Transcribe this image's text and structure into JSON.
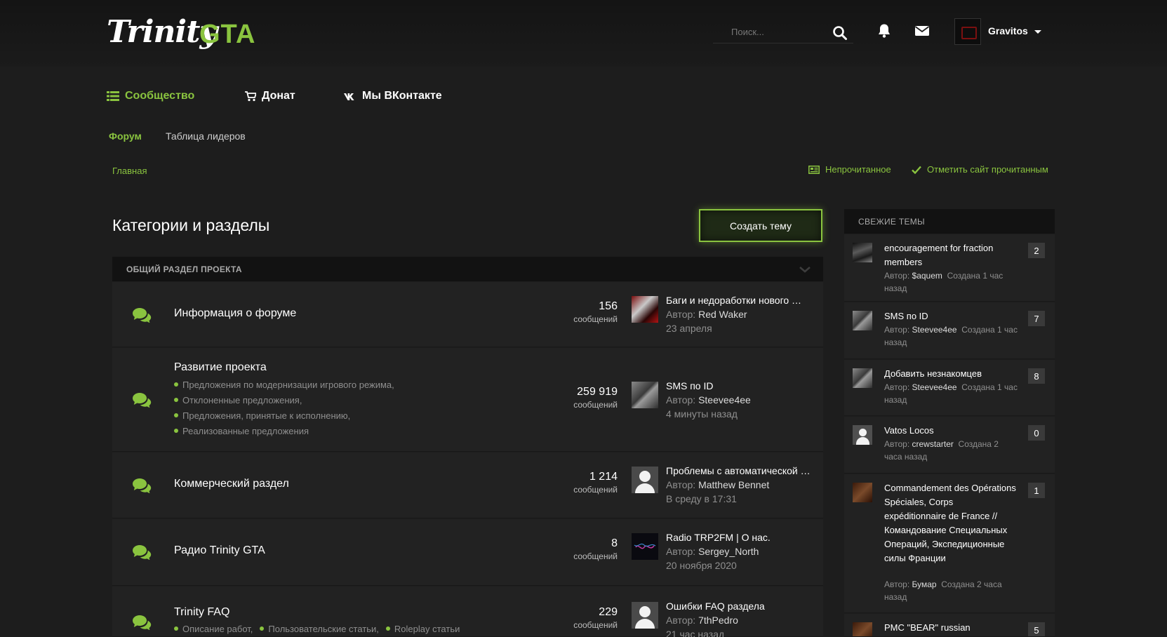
{
  "header": {
    "logo_left": "Trinity",
    "logo_right": "GTA",
    "search_placeholder": "Поиск...",
    "username": "Gravitos"
  },
  "nav": {
    "items": [
      {
        "label": "Сообщество",
        "icon": "list-icon"
      },
      {
        "label": "Донат",
        "icon": "cart-icon"
      },
      {
        "label": "Мы ВКонтакте",
        "icon": "vk-icon"
      }
    ],
    "sub": [
      "Форум",
      "Таблица лидеров"
    ]
  },
  "breadcrumb": "Главная",
  "links": {
    "unread": "Непрочитанное",
    "mark_read": "Отметить сайт прочитанным"
  },
  "page": {
    "title": "Категории и разделы",
    "create_button": "Создать тему",
    "category": "ОБЩИЙ РАЗДЕЛ ПРОЕКТА"
  },
  "forums": [
    {
      "title": "Информация о форуме",
      "subs": [],
      "count": "156",
      "count_label": "сообщений",
      "last_title": "Баги и недоработки нового …",
      "last_author_label": "Автор:",
      "last_author": "Red Waker",
      "last_date": "23 апреля"
    },
    {
      "title": "Развитие проекта",
      "subs": [
        "Предложения по модернизации игрового режима,",
        "Отклоненные предложения,",
        "Предложения, принятые к исполнению,",
        "Реализованные предложения"
      ],
      "count": "259 919",
      "count_label": "сообщений",
      "last_title": "SMS по ID",
      "last_author_label": "Автор:",
      "last_author": "Steevee4ee",
      "last_date": "4 минуты назад"
    },
    {
      "title": "Коммерческий раздел",
      "subs": [],
      "count": "1 214",
      "count_label": "сообщений",
      "last_title": "Проблемы с автоматической …",
      "last_author_label": "Автор:",
      "last_author": "Matthew Bennet",
      "last_date": "В среду в 17:31"
    },
    {
      "title": "Радио Trinity GTA",
      "subs": [],
      "count": "8",
      "count_label": "сообщений",
      "last_title": "Radio TRP2FM | О нас.",
      "last_author_label": "Автор:",
      "last_author": "Sergey_North",
      "last_date": "20 ноября 2020"
    },
    {
      "title": "Trinity FAQ",
      "subs": [
        "Описание работ,",
        "Пользовательские статьи,",
        "Roleplay статьи"
      ],
      "count": "229",
      "count_label": "сообщений",
      "last_title": "Ошибки FAQ раздела",
      "last_author_label": "Автор:",
      "last_author": "7thPedro",
      "last_date": "21 час назад"
    }
  ],
  "sidebar": {
    "title": "СВЕЖИЕ ТЕМЫ",
    "items": [
      {
        "title": "encouragement for fraction members",
        "author_label": "Автор:",
        "author": "$aquem",
        "created": "Создана 1 час назад",
        "count": "2"
      },
      {
        "title": "SMS по ID",
        "author_label": "Автор:",
        "author": "Steevee4ee",
        "created": "Создана 1 час назад",
        "count": "7"
      },
      {
        "title": "Добавить незнакомцев",
        "author_label": "Автор:",
        "author": "Steevee4ee",
        "created": "Создана 1 час назад",
        "count": "8"
      },
      {
        "title": "Vatos Locos",
        "author_label": "Автор:",
        "author": "crewstarter",
        "created": "Создана 2 часа назад",
        "count": "0"
      },
      {
        "title": "Commandement des Opérations Spéciales, Corps expéditionnaire de France // Командование Специальных Операций, Экспедиционные силы Франции",
        "author_label": "Автор:",
        "author": "Бумар",
        "created": "Создана 2 часа назад",
        "count": "1"
      },
      {
        "title": "PMC \"BEAR\" russian",
        "author_label": "",
        "author": "",
        "created": "",
        "count": "5"
      }
    ]
  },
  "colors": {
    "accent": "#8ac43f",
    "background": "#1d1d1d",
    "panel": "#222222",
    "header": "#121212"
  }
}
